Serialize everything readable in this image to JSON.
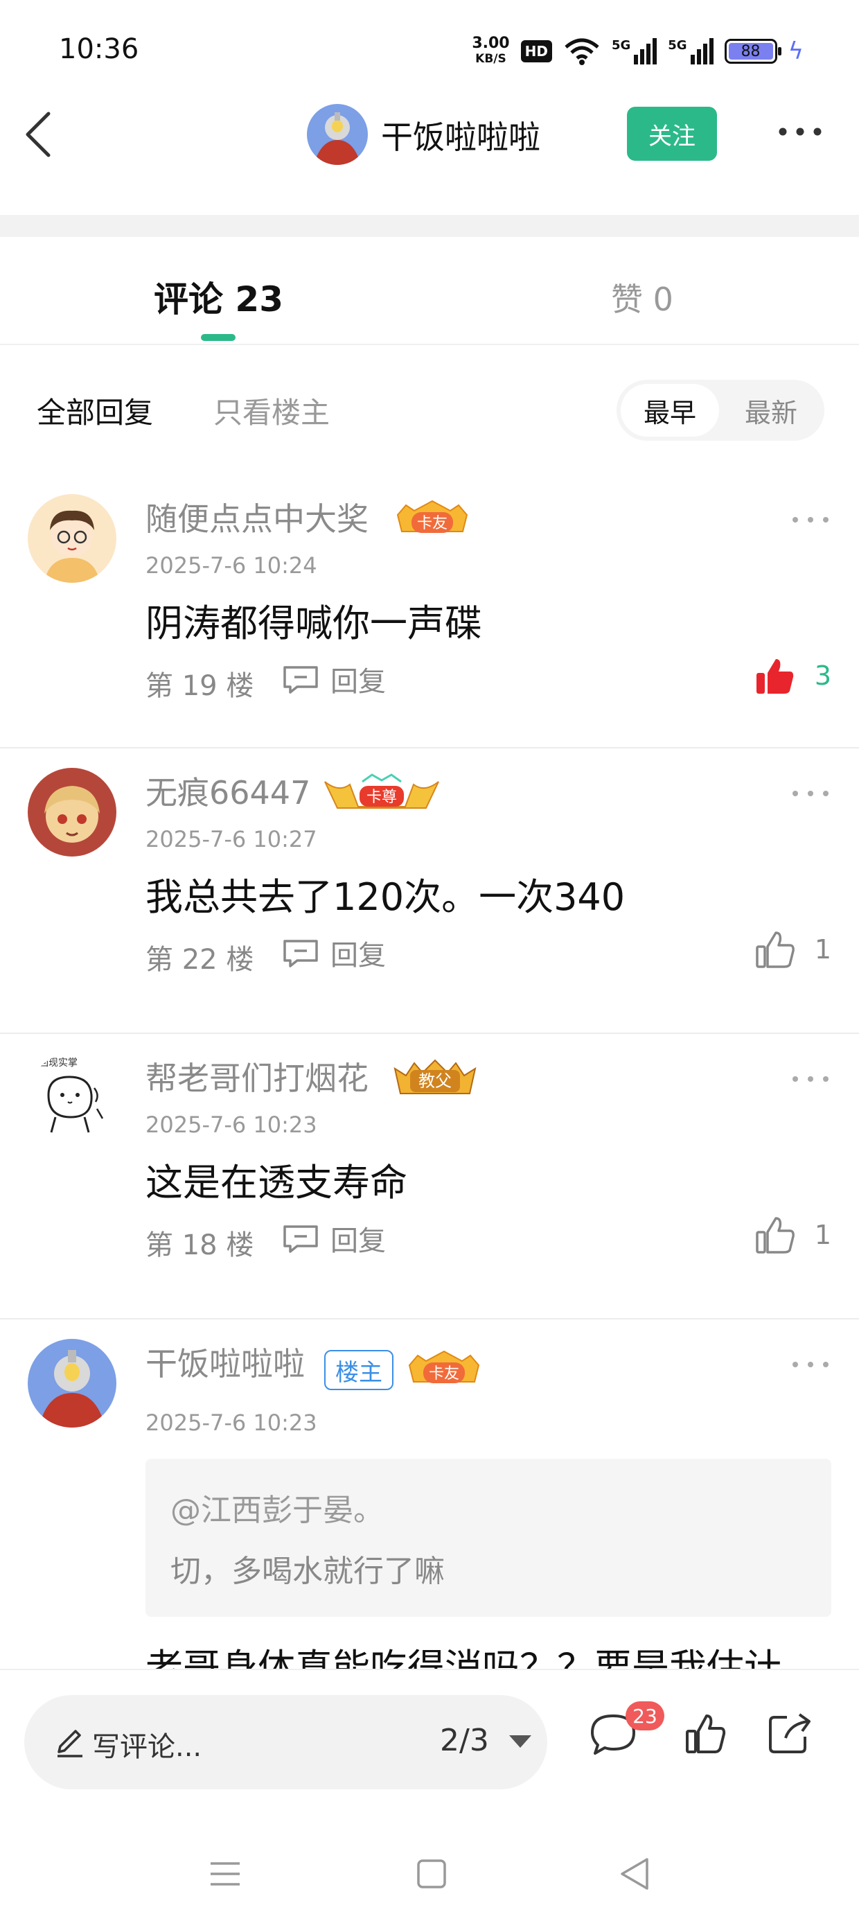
{
  "status_bar": {
    "time": "10:36",
    "speed_value": "3.00",
    "speed_unit": "KB/S",
    "hd": "HD",
    "net1": "5G",
    "net2": "5G",
    "battery": "88"
  },
  "header": {
    "title": "干饭啦啦啦",
    "follow_label": "关注"
  },
  "tabs": {
    "comments_label": "评论 23",
    "likes_label": "赞 0"
  },
  "filters": {
    "all_label": "全部回复",
    "owner_only_label": "只看楼主",
    "sort_earliest": "最早",
    "sort_latest": "最新"
  },
  "comments": [
    {
      "username": "随便点点中大奖",
      "badge": "卡友",
      "time": "2025-7-6 10:24",
      "text": "阴涛都得喊你一声碟",
      "floor": "第 19 楼",
      "reply_label": "回复",
      "likes": "3",
      "liked": true
    },
    {
      "username": "无痕66447",
      "badge": "卡尊",
      "time": "2025-7-6 10:27",
      "text": "我总共去了120次。一次340",
      "floor": "第 22 楼",
      "reply_label": "回复",
      "likes": "1",
      "liked": false
    },
    {
      "username": "帮老哥们打烟花",
      "badge": "教父",
      "avatar_caption": "回现实掌",
      "time": "2025-7-6 10:23",
      "text": "这是在透支寿命",
      "floor": "第 18 楼",
      "reply_label": "回复",
      "likes": "1",
      "liked": false
    },
    {
      "username": "干饭啦啦啦",
      "owner_tag": "楼主",
      "badge": "卡友",
      "time": "2025-7-6 10:23",
      "quote_user": "@江西彭于晏。",
      "quote_text": "切，多喝水就行了嘛",
      "text": "老哥身体真能吃得消吗？？要是我估计"
    }
  ],
  "bottom_bar": {
    "placeholder": "写评论...",
    "page_indicator": "2/3",
    "comment_count": "23"
  },
  "colors": {
    "accent": "#2cb98a",
    "like_red": "#e8252c",
    "owner_blue": "#3b8fe6"
  }
}
